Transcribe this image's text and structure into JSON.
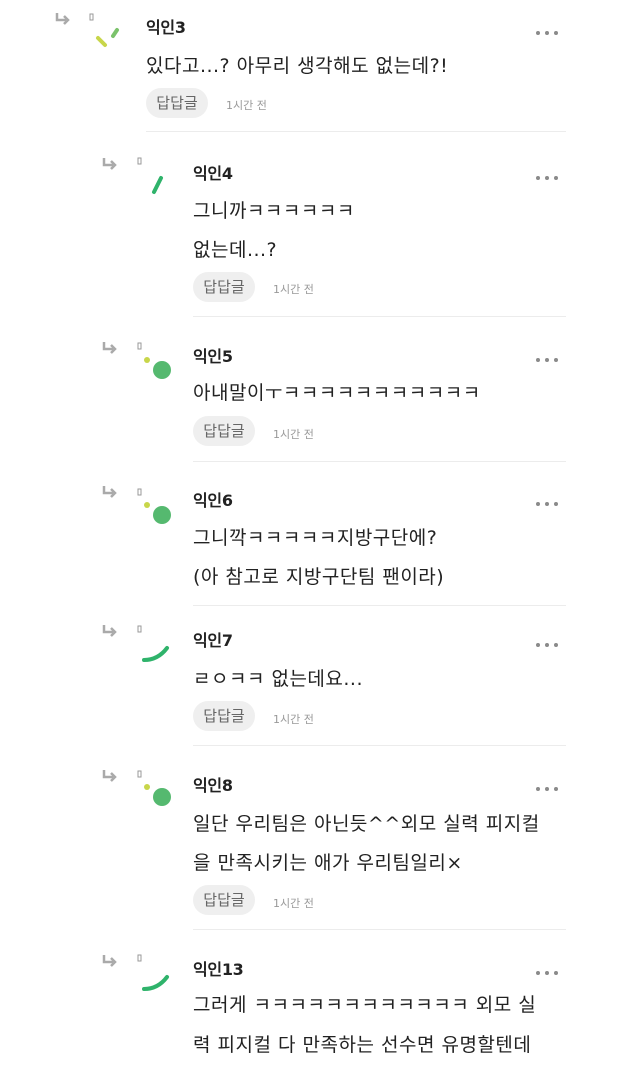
{
  "comments": [
    {
      "name": "익인3",
      "lines": [
        "있다고...? 아무리 생각해도 없는데?!"
      ],
      "reply_label": "답답글",
      "time": "1시간 전"
    },
    {
      "name": "익인4",
      "lines": [
        "그니까ㅋㅋㅋㅋㅋㅋ",
        "없는데...?"
      ],
      "reply_label": "답답글",
      "time": "1시간 전"
    },
    {
      "name": "익인5",
      "lines": [
        "아내말이ㅜㅋㅋㅋㅋㅋㅋㅋㅋㅋㅋㅋ"
      ],
      "reply_label": "답답글",
      "time": "1시간 전"
    },
    {
      "name": "익인6",
      "lines": [
        "그니깍ㅋㅋㅋㅋㅋ지방구단에?",
        "(아 참고로 지방구단팀 팬이라)"
      ]
    },
    {
      "name": "익인7",
      "lines": [
        "ㄹㅇㅋㅋ 없는데요..."
      ],
      "reply_label": "답답글",
      "time": "1시간 전"
    },
    {
      "name": "익인8",
      "lines": [
        "일단 우리팀은 아닌듯^^외모 실력 피지컬",
        "을 만족시키는 애가 우리팀일리×"
      ],
      "reply_label": "답답글",
      "time": "1시간 전"
    },
    {
      "name": "익인13",
      "lines": [
        "그러게 ㅋㅋㅋㅋㅋㅋㅋㅋㅋㅋㅋㅋ 외모 실",
        "력 피지컬 다 만족하는 선수면 유명할텐데"
      ]
    }
  ],
  "icons": {
    "reply_arrow": "reply-arrow-icon",
    "more": "more-options-icon",
    "avatar_colors": [
      "#c8d64a",
      "#2fb36b",
      "#55b96f"
    ]
  }
}
